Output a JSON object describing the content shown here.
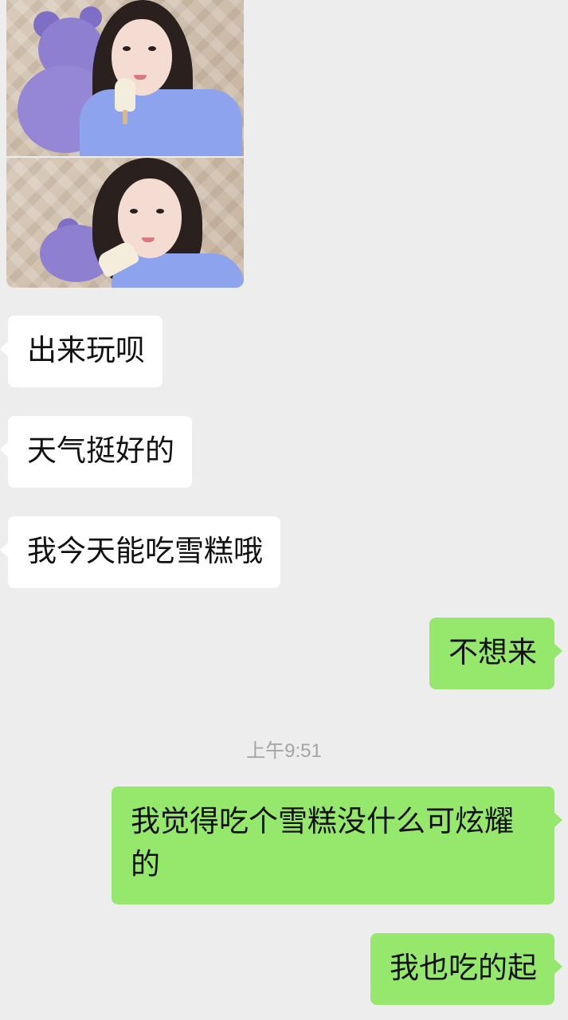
{
  "chat": {
    "shared_image": {
      "name": "selfie-photo-collage"
    },
    "messages": [
      {
        "side": "received",
        "text": "出来玩呗"
      },
      {
        "side": "received",
        "text": "天气挺好的"
      },
      {
        "side": "received",
        "text": "我今天能吃雪糕哦"
      },
      {
        "side": "sent",
        "text": "不想来"
      },
      {
        "side": "sent",
        "text": "我觉得吃个雪糕没什么可炫耀的"
      },
      {
        "side": "sent",
        "text": "我也吃的起"
      }
    ],
    "timestamp": "上午9:51"
  },
  "colors": {
    "background": "#ededed",
    "received_bubble": "#ffffff",
    "sent_bubble": "#95e86c",
    "timestamp_text": "#a4a4a4"
  }
}
